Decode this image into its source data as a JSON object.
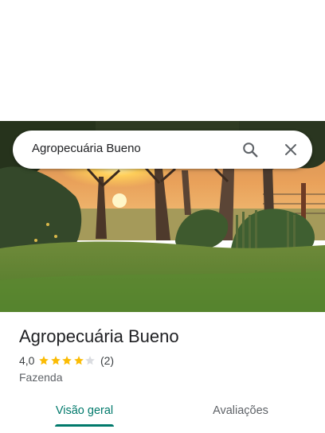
{
  "search": {
    "query": "Agropecuária Bueno",
    "search_icon": "search-icon",
    "close_icon": "close-icon"
  },
  "hero": {
    "description_icon": "place-photo"
  },
  "place": {
    "title": "Agropecuária Bueno",
    "rating": "4,0",
    "rating_value": 4.0,
    "stars_max": 5,
    "review_count": "(2)",
    "category": "Fazenda"
  },
  "tabs": [
    {
      "label": "Visão geral",
      "selected": true
    },
    {
      "label": "Avaliações",
      "selected": false
    }
  ],
  "colors": {
    "accent": "#00796b",
    "star_filled": "#fbbc04",
    "star_empty": "#dadce0"
  }
}
